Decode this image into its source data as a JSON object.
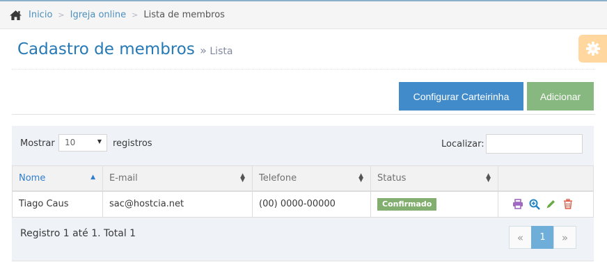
{
  "breadcrumbs": {
    "items": [
      {
        "label": "Inicio"
      },
      {
        "label": "Igreja online"
      },
      {
        "label": "Lista de membros"
      }
    ]
  },
  "header": {
    "title": "Cadastro de membros",
    "subtitle_sep": "»",
    "subtitle": "Lista"
  },
  "toolbar": {
    "config_label": "Configurar Carteirinha",
    "add_label": "Adicionar"
  },
  "table_controls": {
    "show_label": "Mostrar",
    "page_size": "10",
    "records_label": "registros",
    "search_label": "Localizar:",
    "search_value": ""
  },
  "table": {
    "columns": [
      "Nome",
      "E-mail",
      "Telefone",
      "Status",
      ""
    ],
    "rows": [
      {
        "nome": "Tiago Caus",
        "email": "sac@hostcia.net",
        "telefone": "(00) 0000-00000",
        "status": "Confirmado"
      }
    ]
  },
  "footer": {
    "info": "Registro 1 até 1. Total 1",
    "prev": "«",
    "page": "1",
    "next": "»"
  },
  "colors": {
    "title": "#2679b5",
    "primary": "#428bca",
    "success": "#87b87f",
    "badge": "#82af6f",
    "warning": "#ffb752"
  },
  "icons": [
    "home-icon",
    "cog-icon",
    "print-icon",
    "zoom-icon",
    "pencil-icon",
    "trash-icon"
  ]
}
